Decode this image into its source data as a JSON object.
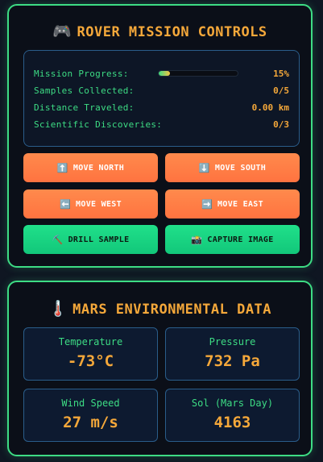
{
  "controls": {
    "title": "ROVER MISSION CONTROLS",
    "icon": "gamepad-icon",
    "status": [
      {
        "label": "Mission Progress:",
        "value": "15%"
      },
      {
        "label": "Samples Collected:",
        "value": "0/5"
      },
      {
        "label": "Distance Traveled:",
        "value": "0.00 km"
      },
      {
        "label": "Scientific Discoveries:",
        "value": "0/3"
      }
    ],
    "progress_fraction": 0.15,
    "buttons": [
      {
        "label": "MOVE NORTH",
        "icon": "arrow-up-icon",
        "glyph": "⬆️"
      },
      {
        "label": "MOVE SOUTH",
        "icon": "arrow-down-icon",
        "glyph": "⬇️"
      },
      {
        "label": "MOVE WEST",
        "icon": "arrow-left-icon",
        "glyph": "⬅️"
      },
      {
        "label": "MOVE EAST",
        "icon": "arrow-right-icon",
        "glyph": "➡️"
      },
      {
        "label": "DRILL SAMPLE",
        "icon": "pickaxe-icon",
        "glyph": "⛏️"
      },
      {
        "label": "CAPTURE IMAGE",
        "icon": "camera-icon",
        "glyph": "📸"
      }
    ]
  },
  "environment": {
    "title": "MARS ENVIRONMENTAL DATA",
    "icon": "thermometer-icon",
    "cards": [
      {
        "label": "Temperature",
        "value": "-73°C"
      },
      {
        "label": "Pressure",
        "value": "732 Pa"
      },
      {
        "label": "Wind Speed",
        "value": "27 m/s"
      },
      {
        "label": "Sol (Mars Day)",
        "value": "4163"
      }
    ]
  },
  "colors": {
    "accent_green": "#3ddc84",
    "accent_orange": "#f5a83a",
    "move_button": "#ff7f45",
    "action_button": "#1ad884"
  }
}
